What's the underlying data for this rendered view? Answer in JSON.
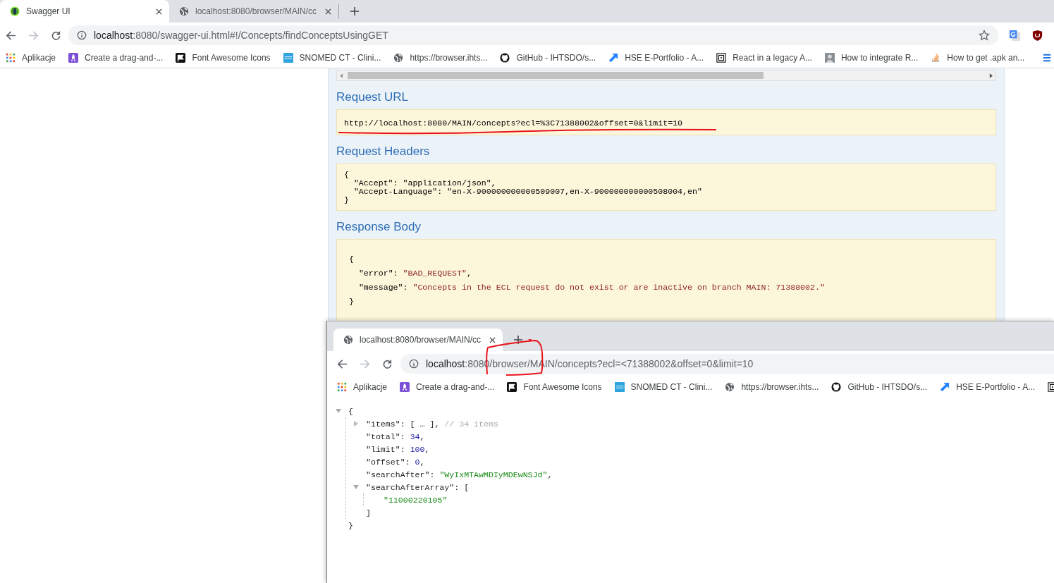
{
  "main_window": {
    "tabs": [
      {
        "title": "Swagger UI",
        "kind": "swagger",
        "selected": true
      },
      {
        "title": "localhost:8080/browser/MAIN/cc",
        "kind": "globe",
        "selected": false
      }
    ],
    "address": {
      "host": "localhost",
      "path": ":8080/swagger-ui.html#!/Concepts/findConceptsUsingGET"
    },
    "bookmarks": [
      {
        "label": "Aplikacje",
        "kind": "apps"
      },
      {
        "label": "Create a drag-and-...",
        "kind": "rocket"
      },
      {
        "label": "Font Awesome Icons",
        "kind": "flag"
      },
      {
        "label": "SNOMED CT - Clini...",
        "kind": "snomed"
      },
      {
        "label": "https://browser.ihts...",
        "kind": "globe"
      },
      {
        "label": "GitHub - IHTSDO/s...",
        "kind": "github"
      },
      {
        "label": "HSE E-Portfolio - A...",
        "kind": "jira"
      },
      {
        "label": "React in a legacy A...",
        "kind": "maze"
      },
      {
        "label": "How to integrate R...",
        "kind": "avatar"
      },
      {
        "label": "How to get .apk an...",
        "kind": "stack"
      }
    ]
  },
  "swagger": {
    "sections": [
      {
        "heading": "Request URL",
        "kind": "url",
        "text": "http://localhost:8080/MAIN/concepts?ecl=%3C71388002&offset=0&limit=10"
      },
      {
        "heading": "Request Headers",
        "kind": "code",
        "lines": [
          "{",
          "  \"Accept\": \"application/json\",",
          "  \"Accept-Language\": \"en-X-900000000000509007,en-X-900000000000508004,en\"",
          "}"
        ]
      },
      {
        "heading": "Response Body",
        "kind": "json",
        "lines": [
          {
            "text": "{"
          },
          {
            "key": "  \"error\": ",
            "value": "\"BAD_REQUEST\"",
            "trail": ","
          },
          {
            "key": "  \"message\": ",
            "value": "\"Concepts in the ECL request do not exist or are inactive on branch MAIN: 71388002.\""
          },
          {
            "text": "}"
          }
        ]
      }
    ]
  },
  "popup_window": {
    "tabs": [
      {
        "title": "localhost:8080/browser/MAIN/cc",
        "kind": "globe",
        "selected": true
      }
    ],
    "address": {
      "host": "localhost",
      "path": ":8080/browser/MAIN/concepts?ecl=<71388002&offset=0&limit=10"
    },
    "bookmarks": [
      {
        "label": "Aplikacje",
        "kind": "apps"
      },
      {
        "label": "Create a drag-and-...",
        "kind": "rocket"
      },
      {
        "label": "Font Awesome Icons",
        "kind": "flag"
      },
      {
        "label": "SNOMED CT - Clini...",
        "kind": "snomed"
      },
      {
        "label": "https://browser.ihts...",
        "kind": "globe"
      },
      {
        "label": "GitHub - IHTSDO/s...",
        "kind": "github"
      },
      {
        "label": "HSE E-Portfolio - A...",
        "kind": "jira"
      },
      {
        "kind": "maze"
      }
    ],
    "json_viewer": {
      "open": "{",
      "close": "}",
      "expanded": true,
      "children": [
        {
          "key": "\"items\": ",
          "summary": "[ … ]",
          "trail": ",",
          "comment": "// 34 items",
          "expanded": false
        },
        {
          "key": "\"total\": ",
          "value": "34",
          "kind": "number",
          "trail": ","
        },
        {
          "key": "\"limit\": ",
          "value": "100",
          "kind": "number",
          "trail": ","
        },
        {
          "key": "\"offset\": ",
          "value": "0",
          "kind": "number",
          "trail": ","
        },
        {
          "key": "\"searchAfter\": ",
          "value": "\"WyIxMTAwMDIyMDEwNSJd\"",
          "kind": "string",
          "trail": ","
        },
        {
          "key": "\"searchAfterArray\": ",
          "open": "[",
          "close": "]",
          "expanded": true,
          "children": [
            {
              "value": "\"11000220105\"",
              "kind": "string"
            }
          ]
        }
      ]
    }
  }
}
